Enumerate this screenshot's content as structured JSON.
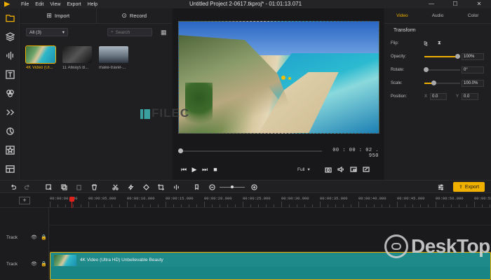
{
  "titlebar": {
    "menu": [
      "File",
      "Edit",
      "View",
      "Export",
      "Help"
    ],
    "title": "Untitled Project 2-0617.tkproj* - 01:01:13.071",
    "controls": [
      "—",
      "☐",
      "✕"
    ]
  },
  "iconbar": {
    "icons": [
      "media-icon",
      "layers-icon",
      "audio-icon",
      "text-icon",
      "effects-icon",
      "transitions-icon",
      "filters-icon",
      "stickers-icon",
      "templates-icon"
    ]
  },
  "media": {
    "import_label": "Import",
    "record_label": "Record",
    "filter_value": "All (3)",
    "search_placeholder": "Search",
    "items": [
      {
        "caption": "4K Video (Ul...",
        "style": "beach"
      },
      {
        "caption": "11 Always B...",
        "style": "dark1"
      },
      {
        "caption": "make-travel-...",
        "style": "city"
      }
    ]
  },
  "preview": {
    "timecode": "00 : 00 : 02 . 950",
    "quality": "Full",
    "watermark": "FILEC"
  },
  "props": {
    "tabs": [
      "Video",
      "Audio",
      "Color"
    ],
    "active_tab": "Video",
    "section": "Transform",
    "flip_label": "Flip:",
    "opacity_label": "Opacity:",
    "opacity_value": "100%",
    "opacity_level": 1.0,
    "rotate_label": "Rotate:",
    "rotate_value": "0°",
    "scale_label": "Scale:",
    "scale_value": "100.0%",
    "position_label": "Position:",
    "pos_x_label": "X",
    "pos_x_value": "0.0",
    "pos_y_label": "Y",
    "pos_y_value": "0.0"
  },
  "toolbar": {
    "export_label": "Export"
  },
  "ruler": {
    "ticks": [
      "00:00:00.000",
      "00:00:05.000",
      "00:00:10.000",
      "00:00:15.000",
      "00:00:20.000",
      "00:00:25.000",
      "00:00:30.000",
      "00:00:35.000",
      "00:00:40.000",
      "00:00:45.000",
      "00:00:50.000",
      "00:00:55.000"
    ]
  },
  "tracks": [
    {
      "name": "Track"
    },
    {
      "name": "Track"
    }
  ],
  "clip": {
    "label": "4K Video (Ultra HD) Unbelievable Beauty"
  },
  "desktop_watermark": "DeskTop",
  "colors": {
    "accent": "#f0b000",
    "playhead": "#e0201a",
    "clip": "#1f8a8a"
  }
}
